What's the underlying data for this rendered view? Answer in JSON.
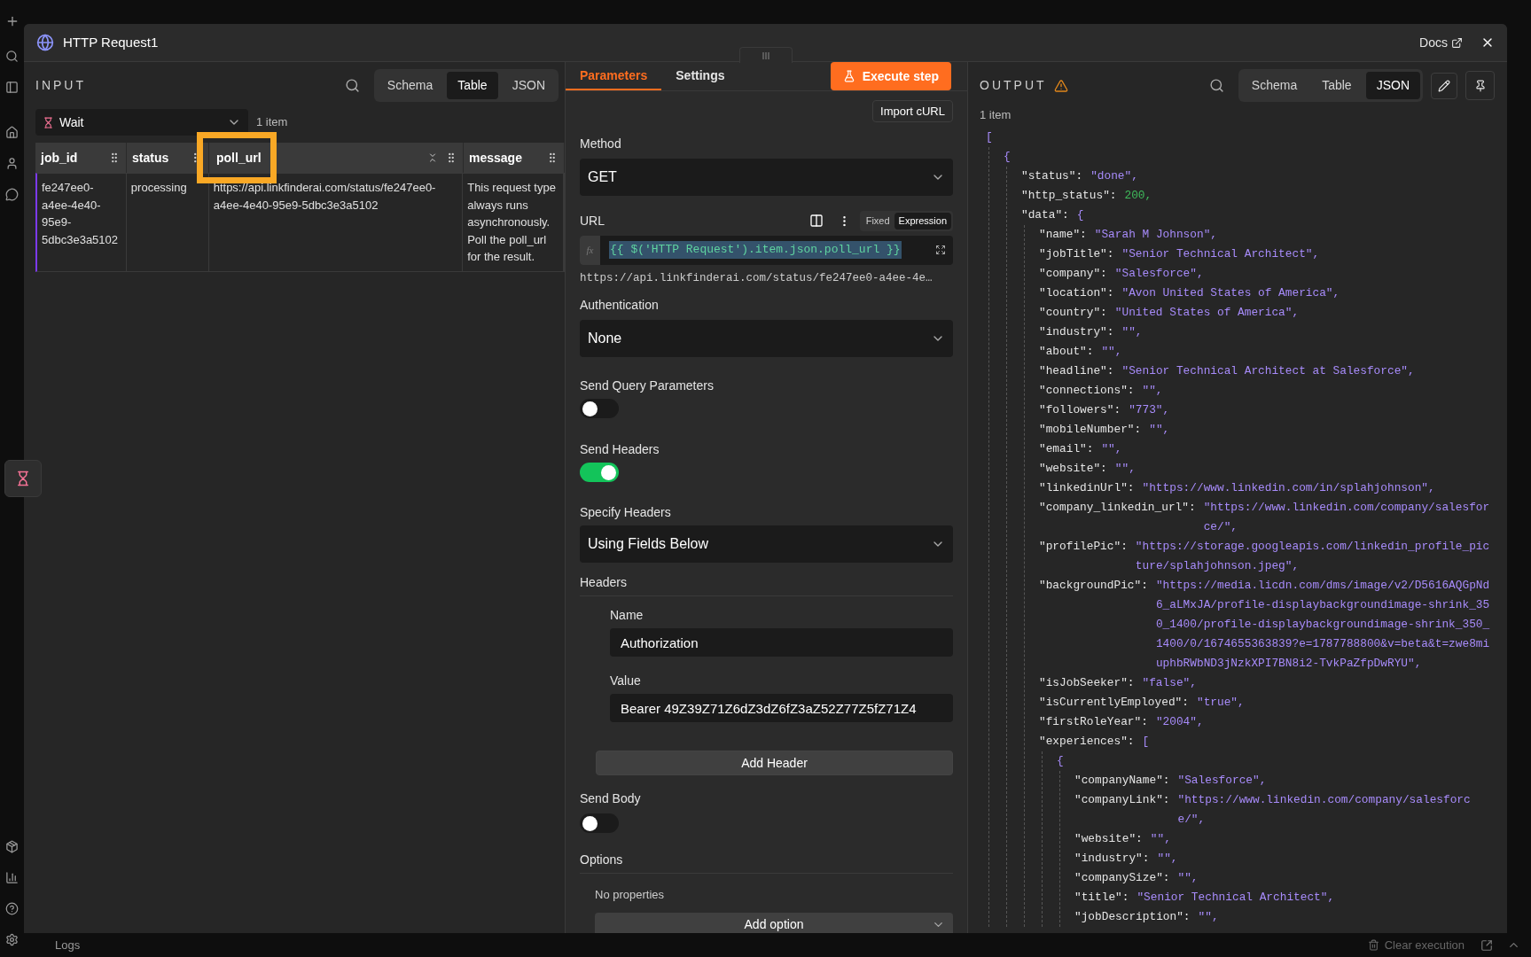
{
  "node_panel": {
    "title": "HTTP Request1",
    "docs_link": "Docs"
  },
  "input": {
    "label": "INPUT",
    "view_tabs": [
      {
        "label": "Schema",
        "selected": false
      },
      {
        "label": "Table",
        "selected": true
      },
      {
        "label": "JSON",
        "selected": false
      }
    ],
    "source": "Wait",
    "item_count": "1 item",
    "table": {
      "columns": [
        {
          "label": "job_id",
          "highlighted": false
        },
        {
          "label": "status",
          "highlighted": false
        },
        {
          "label": "poll_url",
          "highlighted": true
        },
        {
          "label": "message",
          "highlighted": false
        }
      ],
      "rows": [
        [
          "fe247ee0-a4ee-4e40-95e9-5dbc3e3a5102",
          "processing",
          "https://api.linkfinderai.com/status/fe247ee0-a4ee-4e40-95e9-5dbc3e3a5102",
          "This request type always runs asynchronously. Poll the poll_url for the result."
        ]
      ]
    }
  },
  "parameters": {
    "tabs": [
      {
        "label": "Parameters",
        "selected": true
      },
      {
        "label": "Settings",
        "selected": false
      }
    ],
    "execute_button": "Execute step",
    "import_button": "Import cURL",
    "method": {
      "label": "Method",
      "value": "GET"
    },
    "url": {
      "label": "URL",
      "fx_label": "fx",
      "modes": [
        {
          "label": "Fixed",
          "selected": false
        },
        {
          "label": "Expression",
          "selected": true
        }
      ],
      "expression": "{{ $('HTTP Request').item.json.poll_url }}",
      "preview": "https://api.linkfinderai.com/status/fe247ee0-a4ee-4e…"
    },
    "authentication": {
      "label": "Authentication",
      "value": "None"
    },
    "send_query": {
      "label": "Send Query Parameters",
      "on": false
    },
    "send_headers": {
      "label": "Send Headers",
      "on": true
    },
    "specify_headers": {
      "label": "Specify Headers",
      "value": "Using Fields Below"
    },
    "headers": {
      "label": "Headers",
      "items": [
        {
          "name_label": "Name",
          "name": "Authorization",
          "value_label": "Value",
          "value": "Bearer 49Z39Z71Z6dZ3dZ6fZ3aZ52Z77Z5fZ71Z4"
        }
      ],
      "add_button": "Add Header"
    },
    "send_body": {
      "label": "Send Body",
      "on": false
    },
    "options": {
      "label": "Options",
      "empty_text": "No properties",
      "add_button": "Add option"
    }
  },
  "output": {
    "label": "OUTPUT",
    "view_tabs": [
      {
        "label": "Schema",
        "selected": false
      },
      {
        "label": "Table",
        "selected": false
      },
      {
        "label": "JSON",
        "selected": true
      }
    ],
    "item_count": "1 item",
    "json": [
      {
        "open": "[",
        "children": [
          {
            "open": "{",
            "children": [
              {
                "key": "\"status\":",
                "value": "\"done\",",
                "kind": "string"
              },
              {
                "key": "\"http_status\":",
                "value": "200,",
                "kind": "number"
              },
              {
                "key": "\"data\":",
                "open": "{",
                "children": [
                  {
                    "key": "\"name\":",
                    "value": "\"Sarah M Johnson\",",
                    "kind": "string"
                  },
                  {
                    "key": "\"jobTitle\":",
                    "value": "\"Senior Technical Architect\",",
                    "kind": "string"
                  },
                  {
                    "key": "\"company\":",
                    "value": "\"Salesforce\",",
                    "kind": "string"
                  },
                  {
                    "key": "\"location\":",
                    "value": "\"Avon United States of America\",",
                    "kind": "string"
                  },
                  {
                    "key": "\"country\":",
                    "value": "\"United States of America\",",
                    "kind": "string"
                  },
                  {
                    "key": "\"industry\":",
                    "value": "\"\",",
                    "kind": "string"
                  },
                  {
                    "key": "\"about\":",
                    "value": "\"\",",
                    "kind": "string"
                  },
                  {
                    "key": "\"headline\":",
                    "value": "\"Senior Technical Architect at Salesforce\",",
                    "kind": "string"
                  },
                  {
                    "key": "\"connections\":",
                    "value": "\"\",",
                    "kind": "string"
                  },
                  {
                    "key": "\"followers\":",
                    "value": "\"773\",",
                    "kind": "string"
                  },
                  {
                    "key": "\"mobileNumber\":",
                    "value": "\"\",",
                    "kind": "string"
                  },
                  {
                    "key": "\"email\":",
                    "value": "\"\",",
                    "kind": "string"
                  },
                  {
                    "key": "\"website\":",
                    "value": "\"\",",
                    "kind": "string"
                  },
                  {
                    "key": "\"linkedinUrl\":",
                    "value": "\"https://www.linkedin.com/in/splahjohnson\",",
                    "kind": "string"
                  },
                  {
                    "key": "\"company_linkedin_url\":",
                    "value": "\"https://www.linkedin.com/company/salesforce/\",",
                    "kind": "string"
                  },
                  {
                    "key": "\"profilePic\":",
                    "value": "\"https://storage.googleapis.com/linkedin_profile_picture/splahjohnson.jpeg\",",
                    "kind": "string"
                  },
                  {
                    "key": "\"backgroundPic\":",
                    "value": "\"https://media.licdn.com/dms/image/v2/D5616AQGpNd6_aLMxJA/profile-displaybackgroundimage-shrink_350_1400/profile-displaybackgroundimage-shrink_350_1400/0/1674655363839?e=1787788800&v=beta&t=zwe8miuphbRWbND3jNzkXPI7BN8i2-TvkPaZfpDwRYU\",",
                    "kind": "string"
                  },
                  {
                    "key": "\"isJobSeeker\":",
                    "value": "\"false\",",
                    "kind": "string"
                  },
                  {
                    "key": "\"isCurrentlyEmployed\":",
                    "value": "\"true\",",
                    "kind": "string"
                  },
                  {
                    "key": "\"firstRoleYear\":",
                    "value": "\"2004\",",
                    "kind": "string"
                  },
                  {
                    "key": "\"experiences\":",
                    "open": "[",
                    "children": [
                      {
                        "open": "{",
                        "children": [
                          {
                            "key": "\"companyName\":",
                            "value": "\"Salesforce\",",
                            "kind": "string"
                          },
                          {
                            "key": "\"companyLink\":",
                            "value": "\"https://www.linkedin.com/company/salesforce/\",",
                            "kind": "string"
                          },
                          {
                            "key": "\"website\":",
                            "value": "\"\",",
                            "kind": "string"
                          },
                          {
                            "key": "\"industry\":",
                            "value": "\"\",",
                            "kind": "string"
                          },
                          {
                            "key": "\"companySize\":",
                            "value": "\"\",",
                            "kind": "string"
                          },
                          {
                            "key": "\"title\":",
                            "value": "\"Senior Technical Architect\",",
                            "kind": "string"
                          },
                          {
                            "key": "\"jobDescription\":",
                            "value": "\"\",",
                            "kind": "string"
                          }
                        ]
                      }
                    ]
                  }
                ]
              }
            ]
          }
        ]
      }
    ]
  },
  "bottom_bar": {
    "logs": "Logs",
    "clear_button": "Clear execution"
  }
}
